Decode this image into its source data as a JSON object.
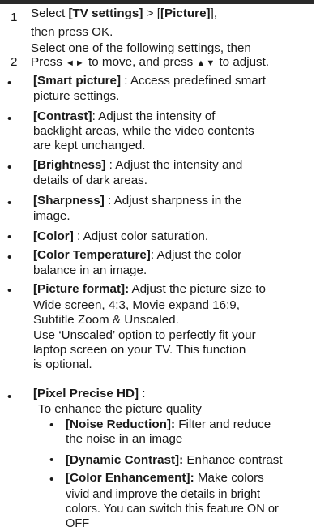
{
  "step1": {
    "num": "1",
    "pre": "Select ",
    "menu1": "[TV settings]",
    "sep": " > ",
    "menu2": "[Picture]",
    "post": ",",
    "line2": "then press OK."
  },
  "step2": {
    "num": "2",
    "line1": "Select one of the following settings, then",
    "p1": "Press ",
    "arrows_lr": "◄►",
    "p2": " to move, and press ",
    "arrows_ud": "▲▼",
    "p3": "  to adjust."
  },
  "bullet": "•",
  "items": {
    "smart_picture": {
      "term": "[Smart picture]",
      "l1": " : Access predefined smart",
      "l2": "picture settings."
    },
    "contrast": {
      "term": "[Contrast]",
      "l1": ": Adjust the intensity of",
      "l2": "backlight areas, while the video contents",
      "l3": "are kept unchanged."
    },
    "brightness": {
      "term": "[Brightness]",
      "l1": " : Adjust the intensity and",
      "l2": "details of dark areas."
    },
    "sharpness": {
      "term": "[Sharpness]",
      "l1": " : Adjust sharpness in the",
      "l2": "image."
    },
    "color": {
      "term": "[Color]",
      "l1": " : Adjust color saturation."
    },
    "color_temperature": {
      "term": "[Color Temperature]",
      "l1": ": Adjust the color",
      "l2": "balance in an image."
    },
    "picture_format": {
      "term": "[Picture format]:",
      "l1": " Adjust the picture size to",
      "l2": "Wide screen, 4:3, Movie expand 16:9,",
      "l3": "Subtitle Zoom & Unscaled.",
      "l4": "Use ‘Unscaled’  option to perfectly fit your",
      "l5": "laptop screen on your TV. This function",
      "l6": "is optional."
    },
    "pixel_precise": {
      "term": "[Pixel Precise HD]",
      "l1": " :",
      "l2": "To enhance the picture quality"
    },
    "noise_reduction": {
      "term": "[Noise Reduction]:",
      "l1": " Filter and reduce",
      "l2": "the noise in an image"
    },
    "dynamic_contrast": {
      "term": "[Dynamic Contrast]:",
      "l1": " Enhance contrast"
    },
    "color_enhancement": {
      "term": "[Color Enhancement]:",
      "l1": " Make colors",
      "l2": "vivid and improve the details in bright",
      "l3": "colors. You can switch this feature ON or",
      "l4": "OFF"
    }
  }
}
